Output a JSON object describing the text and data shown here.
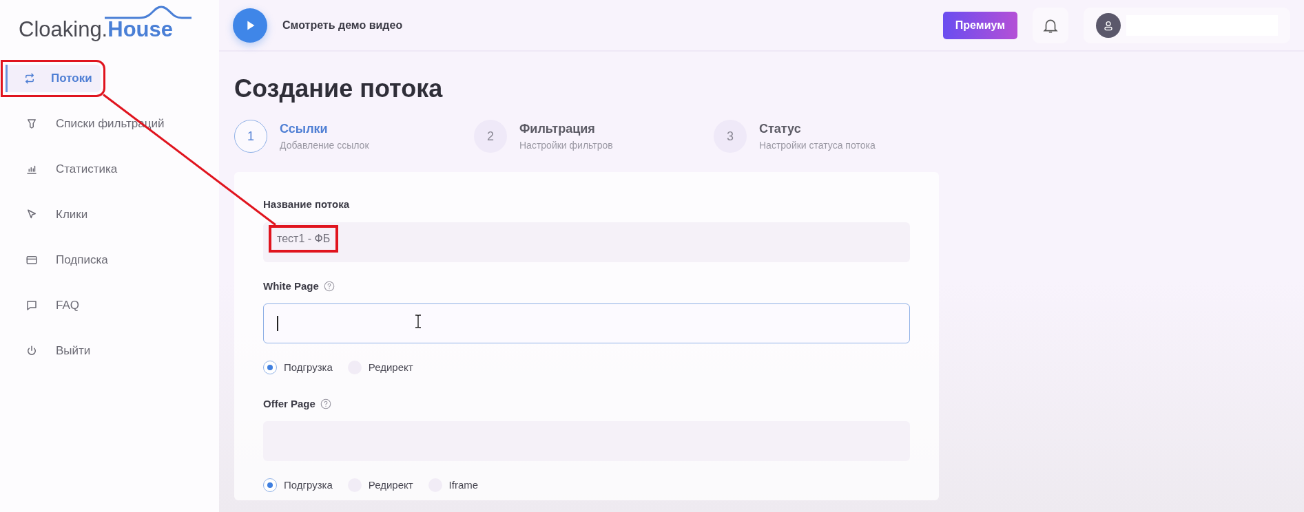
{
  "logo": {
    "text": "Cloaking.",
    "accent": "House"
  },
  "sidebar": {
    "items": [
      {
        "label": "Потоки",
        "selected": true,
        "highlighted": true
      },
      {
        "label": "Списки фильтраций",
        "selected": false,
        "highlighted": false
      },
      {
        "label": "Статистика",
        "selected": false,
        "highlighted": false
      },
      {
        "label": "Клики",
        "selected": false,
        "highlighted": false
      },
      {
        "label": "Подписка",
        "selected": false,
        "highlighted": false
      },
      {
        "label": "FAQ",
        "selected": false,
        "highlighted": false
      },
      {
        "label": "Выйти",
        "selected": false,
        "highlighted": false
      }
    ]
  },
  "header": {
    "demo_link": "Смотреть демо видео",
    "premium_button": "Премиум"
  },
  "page_title": "Создание потока",
  "steps": [
    {
      "number": "1",
      "title": "Ссылки",
      "subtitle": "Добавление ссылок",
      "selected": true
    },
    {
      "number": "2",
      "title": "Фильтрация",
      "subtitle": "Настройки фильтров",
      "selected": false
    },
    {
      "number": "3",
      "title": "Статус",
      "subtitle": "Настройки статуса потока",
      "selected": false
    }
  ],
  "form": {
    "fields": [
      {
        "label": "Название потока",
        "help": false,
        "value": "тест1 - ФБ",
        "focused": false,
        "highlighted": true
      },
      {
        "label": "White Page",
        "help": true,
        "focused": true,
        "highlighted": false,
        "options": [
          {
            "label": "Подгрузка",
            "selected": true
          },
          {
            "label": "Редирект",
            "selected": false
          }
        ]
      },
      {
        "label": "Offer Page",
        "help": true,
        "focused": false,
        "highlighted": false,
        "options": [
          {
            "label": "Подгрузка",
            "selected": true
          },
          {
            "label": "Редирект",
            "selected": false
          },
          {
            "label": "Iframe",
            "selected": false
          }
        ]
      }
    ]
  }
}
